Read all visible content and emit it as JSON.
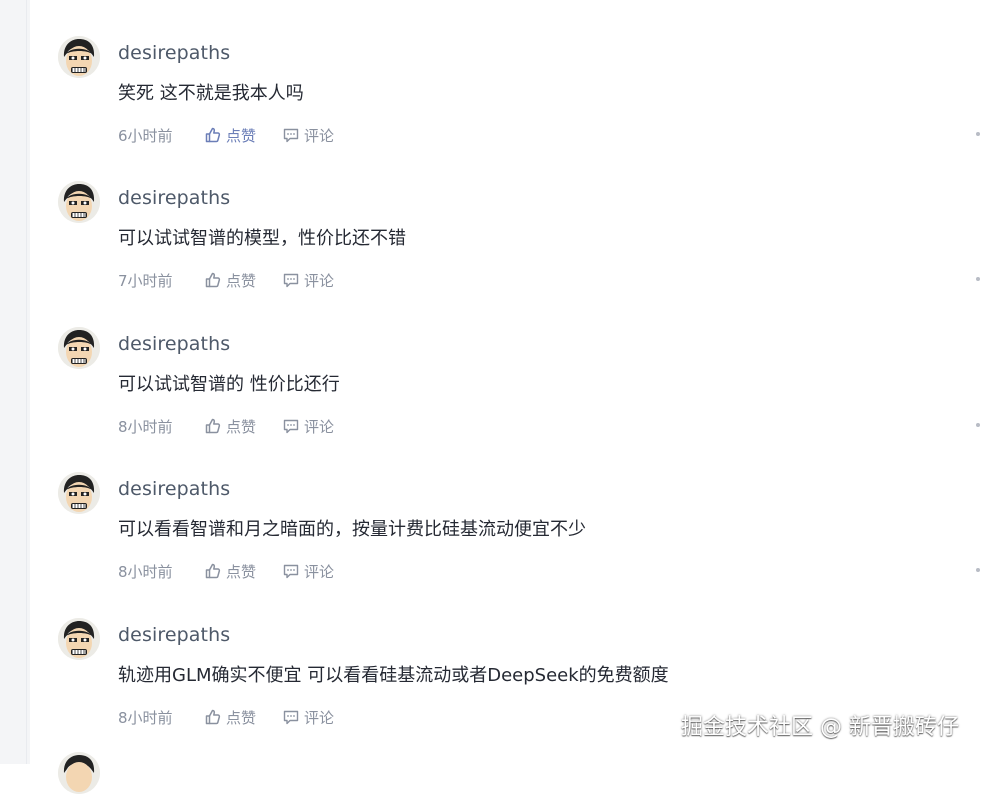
{
  "colors": {
    "username": "#4e5969",
    "content": "#252933",
    "meta": "#8a919f",
    "liked": "#6b7eb7",
    "watermark": "#ffffff"
  },
  "icons": {
    "like": "thumbs-up-icon",
    "comment": "comment-bubble-icon",
    "more": "more-dot-icon",
    "avatar": "cartoon-face-avatar"
  },
  "comments": [
    {
      "username": "desirepaths",
      "content": "笑死 这不就是我本人吗",
      "time": "6小时前",
      "like_label": "点赞",
      "comment_label": "评论",
      "liked": true
    },
    {
      "username": "desirepaths",
      "content": "可以试试智谱的模型，性价比还不错",
      "time": "7小时前",
      "like_label": "点赞",
      "comment_label": "评论",
      "liked": false
    },
    {
      "username": "desirepaths",
      "content": "可以试试智谱的 性价比还行",
      "time": "8小时前",
      "like_label": "点赞",
      "comment_label": "评论",
      "liked": false
    },
    {
      "username": "desirepaths",
      "content": "可以看看智谱和月之暗面的，按量计费比硅基流动便宜不少",
      "time": "8小时前",
      "like_label": "点赞",
      "comment_label": "评论",
      "liked": false
    },
    {
      "username": "desirepaths",
      "content": "轨迹用GLM确实不便宜 可以看看硅基流动或者DeepSeek的免费额度",
      "time": "8小时前",
      "like_label": "点赞",
      "comment_label": "评论",
      "liked": false
    }
  ],
  "watermark": "掘金技术社区 @ 新晋搬砖仔"
}
